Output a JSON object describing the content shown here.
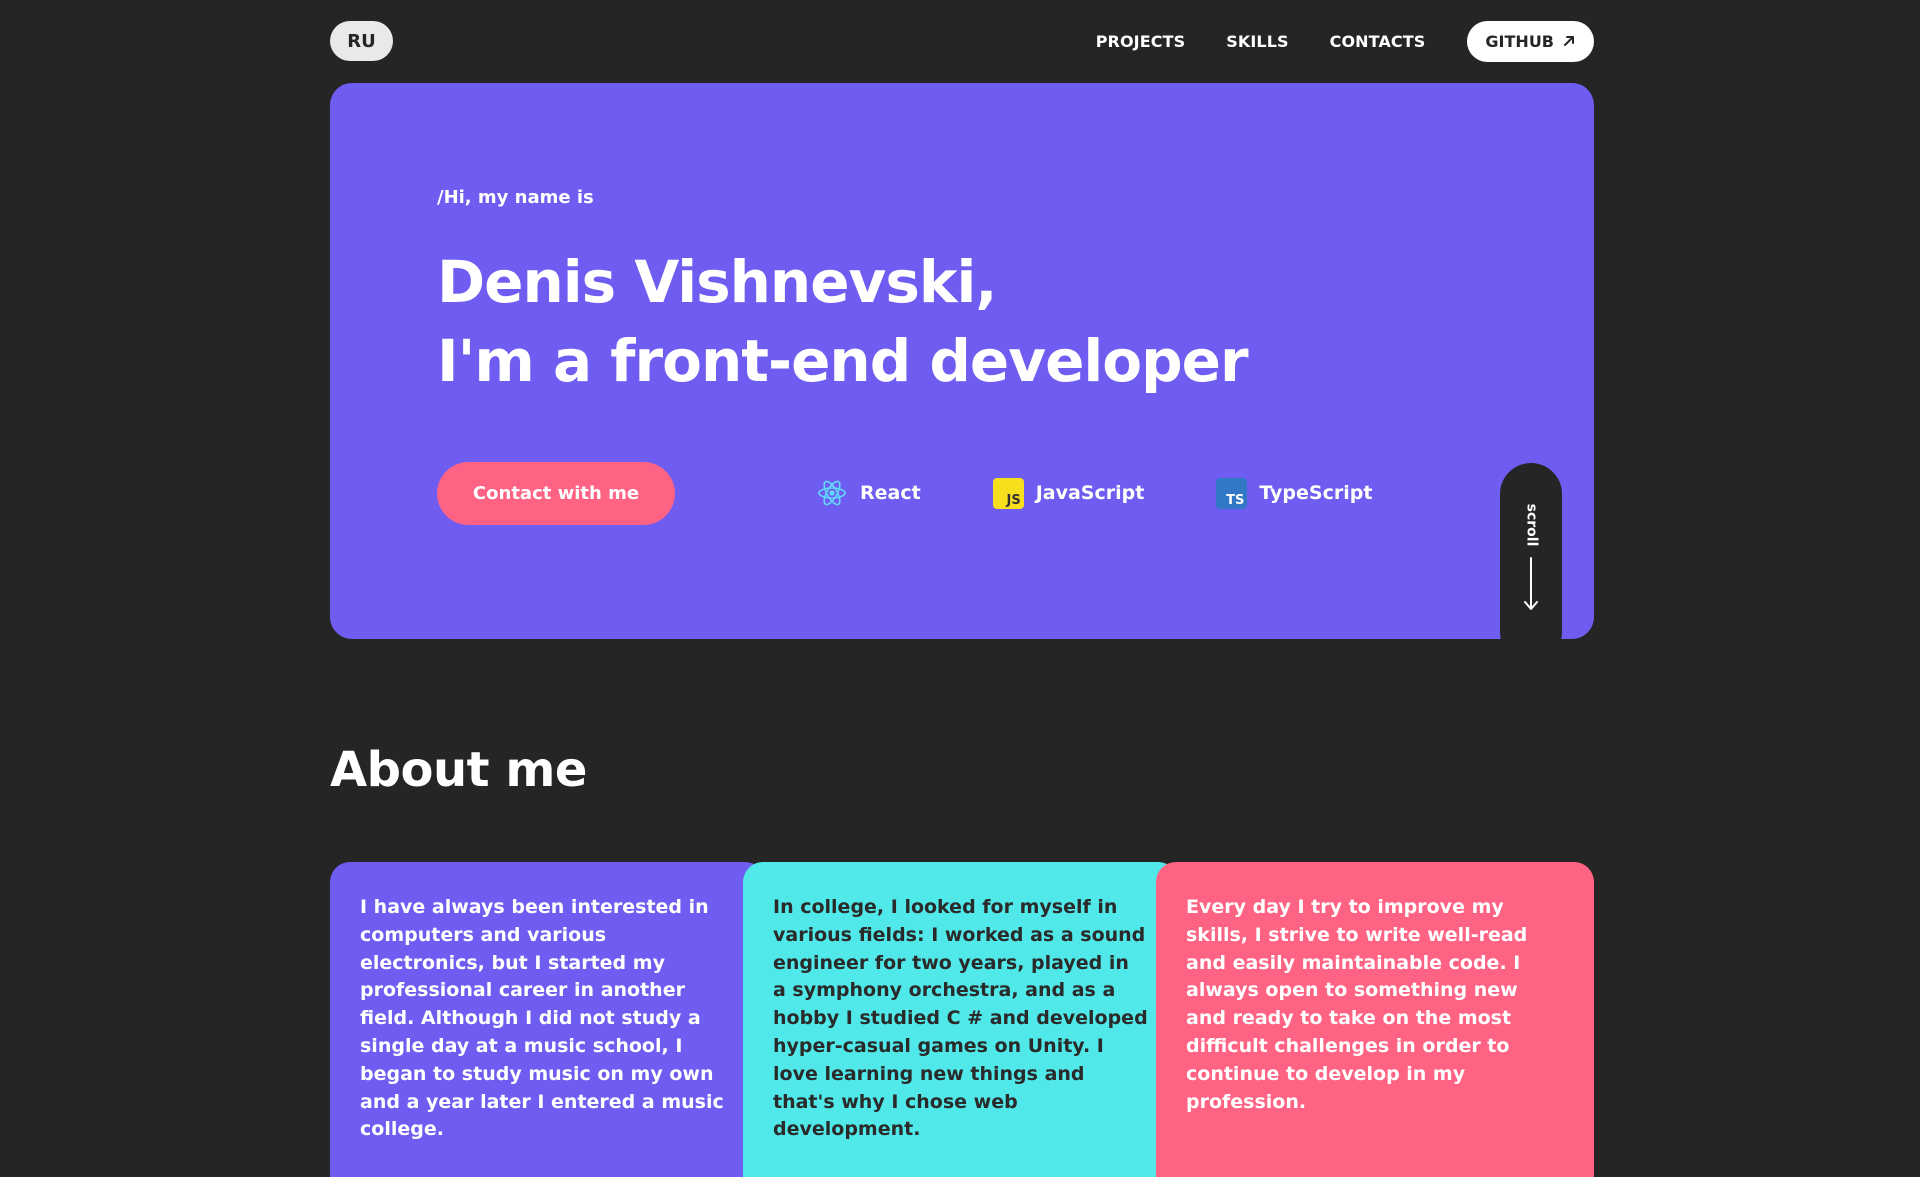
{
  "header": {
    "lang_label": "RU",
    "nav": [
      "PROJECTS",
      "SKILLS",
      "CONTACTS"
    ],
    "github_label": "GITHUB"
  },
  "hero": {
    "intro": "/Hi, my name is",
    "title_line1": "Denis Vishnevski,",
    "title_line2": "I'm a front-end developer",
    "cta_label": "Contact with me",
    "skills": [
      {
        "label": "React",
        "icon": "react-icon"
      },
      {
        "label": "JavaScript",
        "icon": "javascript-icon",
        "badge": "JS"
      },
      {
        "label": "TypeScript",
        "icon": "typescript-icon",
        "badge": "TS"
      }
    ],
    "scroll_label": "scroll"
  },
  "about": {
    "title": "About me",
    "cards": [
      {
        "text": "I have always been interested in computers and various electronics, but I started my professional career in another field. Although I did not study a single day at a music school, I began to study music on my own and a year later I entered a music college."
      },
      {
        "text": "In college, I looked for myself in various fields: I worked as a sound engineer for two years, played in a symphony orchestra, and as a hobby I studied C # and developed hyper-casual games on Unity. I love learning new things and that's why I chose web development."
      },
      {
        "text": "Every day I try to improve my skills, I strive to write well-read and easily maintainable code. I always open to something new and ready to take on the most difficult challenges in order to continue to develop in my profession."
      }
    ]
  },
  "colors": {
    "background": "#252525",
    "purple": "#6f5cf0",
    "cyan": "#50e8e8",
    "pink": "#ff6384"
  }
}
